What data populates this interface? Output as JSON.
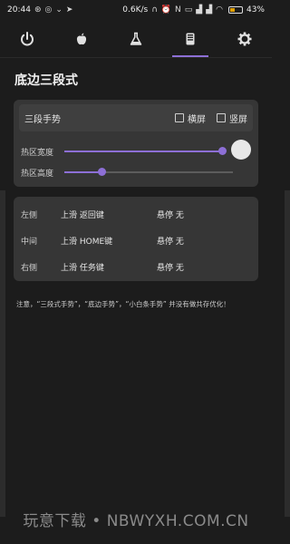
{
  "status": {
    "time": "20:44",
    "speed": "0.6K/s",
    "battery": "43%",
    "battery_level": 0.43,
    "icons": [
      "notification-icon",
      "wechat-icon",
      "chevron-icon",
      "send-icon",
      "headphone-icon",
      "alarm-icon",
      "nfc-icon",
      "vpn-icon",
      "signal-icon",
      "signal-icon",
      "wifi-icon"
    ]
  },
  "tabs": [
    {
      "name": "power-icon"
    },
    {
      "name": "apple-icon"
    },
    {
      "name": "flask-icon"
    },
    {
      "name": "sd-card-icon",
      "active": true
    },
    {
      "name": "gear-icon"
    }
  ],
  "page": {
    "title": "底边三段式"
  },
  "settings": {
    "header_label": "三段手势",
    "landscape_label": "横屏",
    "portrait_label": "竖屏",
    "width_label": "热区宽度",
    "width_value": 0.98,
    "height_label": "热区高度",
    "height_value": 0.22
  },
  "gestures": [
    {
      "position": "左侧",
      "swipe": "上滑 返回键",
      "hover": "悬停 无"
    },
    {
      "position": "中间",
      "swipe": "上滑 HOME键",
      "hover": "悬停 无"
    },
    {
      "position": "右侧",
      "swipe": "上滑 任务键",
      "hover": "悬停 无"
    }
  ],
  "note": "注意，“三段式手势”，“底边手势”，“小白条手势” 并没有做共存优化！",
  "watermark": "玩意下载 • NBWYXH.COM.CN",
  "colors": {
    "accent": "#8d6fd6",
    "background": "#1c1c1c",
    "card": "#363636"
  }
}
